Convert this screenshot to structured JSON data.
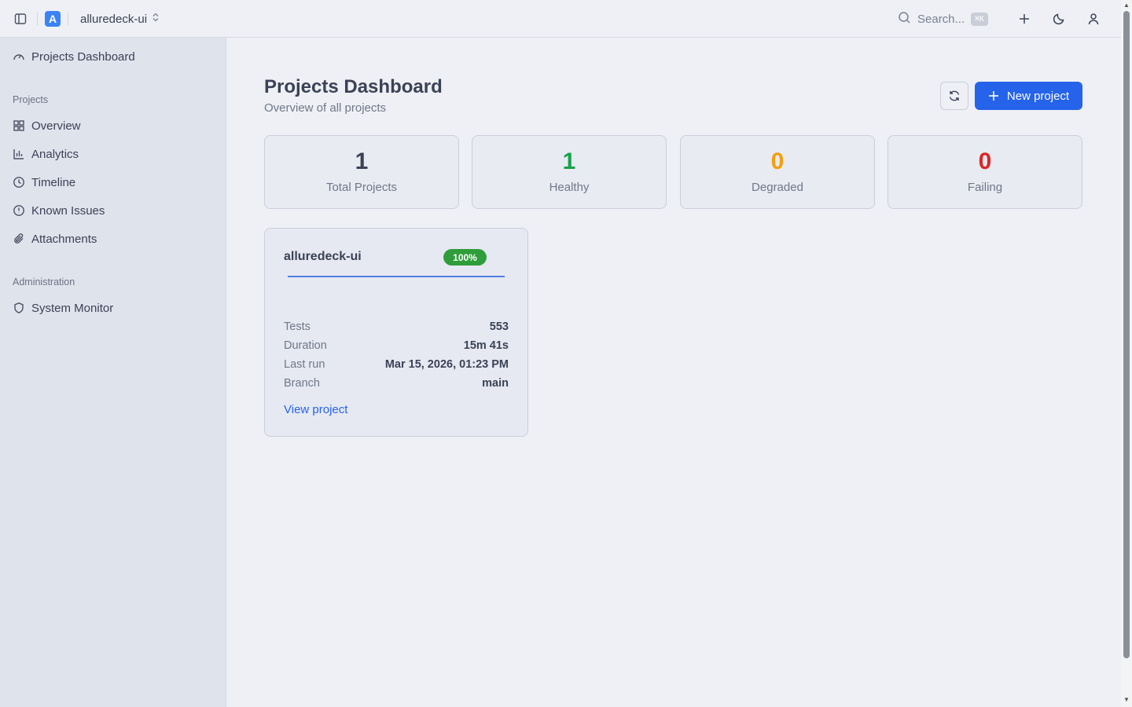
{
  "header": {
    "project_name": "alluredeck-ui",
    "app_logo_letter": "A",
    "search_placeholder": "Search...",
    "search_shortcut": "⌘K"
  },
  "sidebar": {
    "top_item": "Projects Dashboard",
    "projects_group": "Projects",
    "projects_items": [
      "Overview",
      "Analytics",
      "Timeline",
      "Known Issues",
      "Attachments"
    ],
    "admin_group": "Administration",
    "admin_items": [
      "System Monitor"
    ]
  },
  "main": {
    "title": "Projects Dashboard",
    "subtitle": "Overview of all projects",
    "new_project_label": "New project",
    "stats": [
      {
        "value": "1",
        "label": "Total Projects",
        "color": "#3b4256"
      },
      {
        "value": "1",
        "label": "Healthy",
        "color": "#16a34a"
      },
      {
        "value": "0",
        "label": "Degraded",
        "color": "#f59e0b"
      },
      {
        "value": "0",
        "label": "Failing",
        "color": "#dc2626"
      }
    ],
    "project_card": {
      "name": "alluredeck-ui",
      "badge": "100%",
      "pass_rate": 1.0,
      "rows": [
        {
          "key": "Tests",
          "value": "553"
        },
        {
          "key": "Duration",
          "value": "15m 41s"
        },
        {
          "key": "Last run",
          "value": "Mar 15, 2026, 01:23 PM"
        },
        {
          "key": "Branch",
          "value": "main"
        }
      ],
      "link": "View project"
    }
  }
}
